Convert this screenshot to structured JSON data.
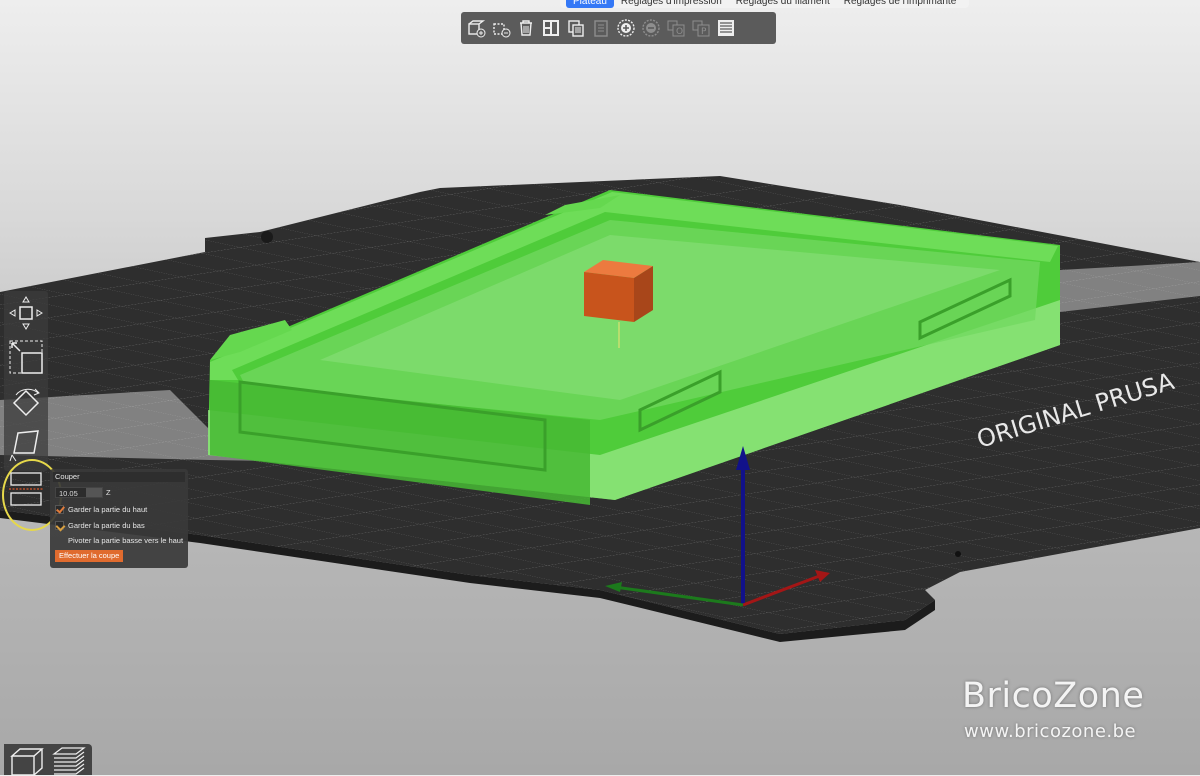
{
  "tabs": [
    {
      "label": "Plateau",
      "active": true
    },
    {
      "label": "Réglages d'impression",
      "active": false
    },
    {
      "label": "Réglages du filament",
      "active": false
    },
    {
      "label": "Réglages de l'imprimante",
      "active": false
    }
  ],
  "toolbar": {
    "icons": [
      "add-icon",
      "delete-icon",
      "delete-all-icon",
      "arrange-icon",
      "copy-icon",
      "paste-icon",
      "add-instance-icon",
      "remove-instance-icon",
      "split-objects-icon",
      "split-parts-icon",
      "layers-editing-icon"
    ]
  },
  "bed": {
    "brand_text": "ORIGINAL PRUSA",
    "colors": {
      "bed": "#2e2e2e",
      "model": "#4fcc3a",
      "cube": "#d8581e"
    }
  },
  "cut_panel": {
    "title": "Couper",
    "value": "10.05",
    "axis": "Z",
    "keep_top": {
      "label": "Garder la partie du haut",
      "checked": true
    },
    "keep_bottom": {
      "label": "Garder la partie du bas",
      "checked": false
    },
    "flip_bottom": {
      "label": "Pivoter la partie basse vers le haut",
      "checked": false
    },
    "apply_label": "Effectuer la coupe"
  },
  "watermark": {
    "title": "BricoZone",
    "url": "www.bricozone.be"
  }
}
